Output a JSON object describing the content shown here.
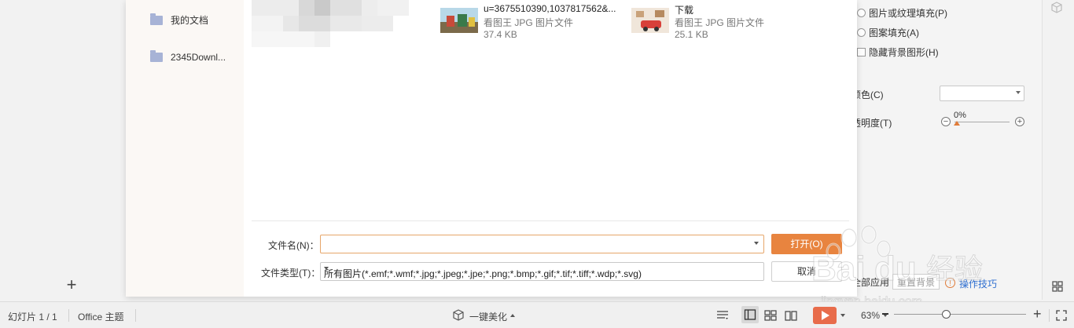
{
  "right_panel": {
    "fill_picture": "图片或纹理填充(P)",
    "fill_pattern": "图案填充(A)",
    "hide_bg": "隐藏背景图形(H)",
    "color_label": "颜色(C)",
    "transparency_label": "透明度(T)",
    "transparency_value": "0%",
    "apply_all": "全部应用",
    "reset_bg": "重置背景",
    "tips": "操作技巧"
  },
  "dialog": {
    "nav": [
      {
        "label": "我的文档"
      },
      {
        "label": "2345Downl..."
      }
    ],
    "files": [
      {
        "name": "u=3675510390,1037817562&...",
        "type": "看图王 JPG 图片文件",
        "size": "37.4 KB"
      },
      {
        "name": "下载",
        "type": "看图王 JPG 图片文件",
        "size": "25.1 KB"
      }
    ],
    "filename_label": "文件名(N)：",
    "filename_value": "",
    "filetype_label": "文件类型(T)：",
    "filetype_value": "所有图片(*.emf;*.wmf;*.jpg;*.jpeg;*.jpe;*.png;*.bmp;*.gif;*.tif;*.tiff;*.wdp;*.svg)",
    "open_button": "打开(O)",
    "cancel_button": "取消"
  },
  "statusbar": {
    "slide_info": "幻灯片 1 / 1",
    "theme": "Office 主题",
    "beautify": "一键美化",
    "zoom": "63%"
  },
  "colors": {
    "accent": "#e8843f",
    "play": "#e86c4b",
    "link": "#2f6fd0"
  }
}
